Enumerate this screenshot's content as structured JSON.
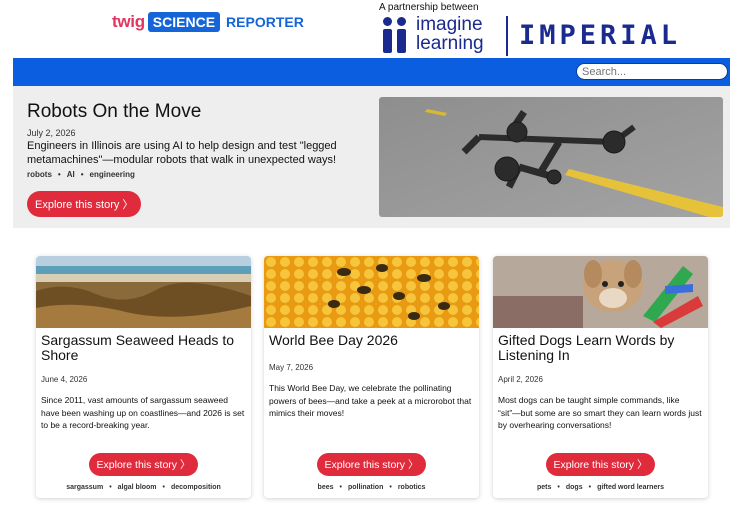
{
  "brand": {
    "twig": "twig",
    "science": "SCIENCE",
    "reporter": "REPORTER"
  },
  "partner": {
    "intro": "A partnership between",
    "imagine_line1": "imagine",
    "imagine_line2": "learning",
    "imperial": "IMPERIAL"
  },
  "search": {
    "placeholder": "Search..."
  },
  "hero": {
    "title": "Robots On the Move",
    "date": "July 2, 2026",
    "summary": "Engineers in Illinois are using AI to help design and test \"legged metamachines\"—modular robots that walk in unexpected ways!",
    "tags": [
      "robots",
      "AI",
      "engineering"
    ],
    "button": "Explore this story 〉"
  },
  "cards": [
    {
      "title": "Sargassum Seaweed Heads to Shore",
      "date": "June 4, 2026",
      "summary": "Since 2011, vast amounts of sargassum seaweed have been washing up on coastlines—and 2026 is set to be a record-breaking year.",
      "button": "Explore this story 〉",
      "tags": [
        "sargassum",
        "algal bloom",
        "decomposition"
      ]
    },
    {
      "title": "World Bee Day 2026",
      "date": "May 7, 2026",
      "summary": "This World Bee Day, we celebrate the pollinating powers of bees—and take a peek at a microrobot that mimics their moves!",
      "button": "Explore this story 〉",
      "tags": [
        "bees",
        "pollination",
        "robotics"
      ]
    },
    {
      "title": "Gifted Dogs Learn Words by Listening In",
      "date": "April 2, 2026",
      "summary": "Most dogs can be taught simple commands, like “sit”—but some are so smart they can learn words just by overhearing conversations!",
      "button": "Explore this story 〉",
      "tags": [
        "pets",
        "dogs",
        "gifted word learners"
      ]
    }
  ],
  "colors": {
    "accent_blue": "#0b5ee0",
    "brand_pink": "#e23560",
    "button_red": "#e02b3d",
    "navy": "#1b2a8f"
  }
}
